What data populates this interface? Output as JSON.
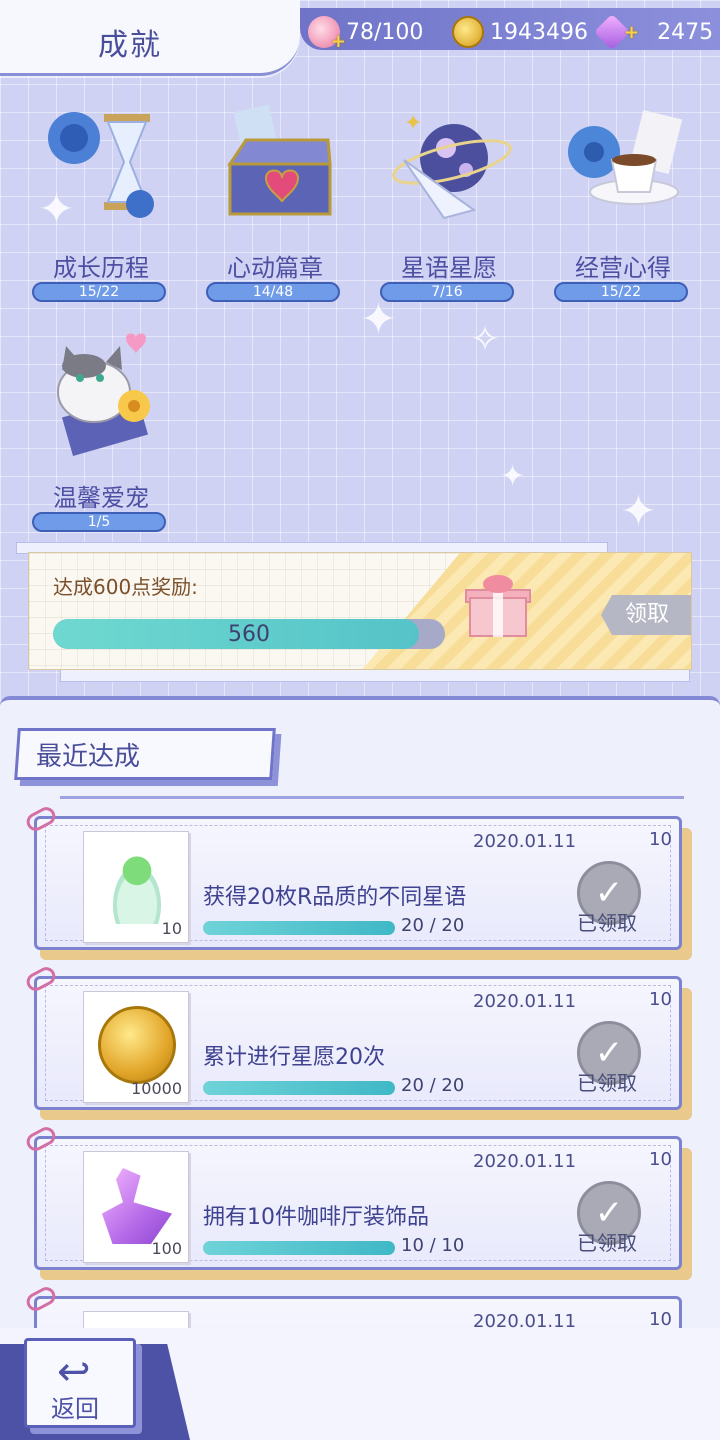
{
  "header": {
    "title": "成就",
    "stamina": "78/100",
    "coins": "1943496",
    "gems": "2475"
  },
  "categories": [
    {
      "label": "成长历程",
      "progress": "15/22",
      "icon": "hourglass-rose-icon"
    },
    {
      "label": "心动篇章",
      "progress": "14/48",
      "icon": "heart-box-icon"
    },
    {
      "label": "星语星愿",
      "progress": "7/16",
      "icon": "planet-star-icon"
    },
    {
      "label": "经营心得",
      "progress": "15/22",
      "icon": "coffee-cup-icon"
    },
    {
      "label": "温馨爱宠",
      "progress": "1/5",
      "icon": "cat-pet-icon"
    }
  ],
  "reward": {
    "title": "达成600点奖励:",
    "current": "560",
    "fraction": 0.933,
    "claim_label": "领取"
  },
  "recent": {
    "title": "最近达成",
    "items": [
      {
        "date": "2020.01.11",
        "points": "10",
        "desc": "获得20枚R品质的不同星语",
        "progress": "20 / 20",
        "item_count": "10",
        "icon": "clover-bowl-icon",
        "status": "已领取"
      },
      {
        "date": "2020.01.11",
        "points": "10",
        "desc": "累计进行星愿20次",
        "progress": "20 / 20",
        "item_count": "10000",
        "icon": "gold-coin-icon",
        "status": "已领取"
      },
      {
        "date": "2020.01.11",
        "points": "10",
        "desc": "拥有10件咖啡厅装饰品",
        "progress": "10 / 10",
        "item_count": "100",
        "icon": "crystal-swan-icon",
        "status": "已领取"
      },
      {
        "date": "2020.01.11",
        "points": "10"
      }
    ]
  },
  "footer": {
    "back_label": "返回"
  }
}
